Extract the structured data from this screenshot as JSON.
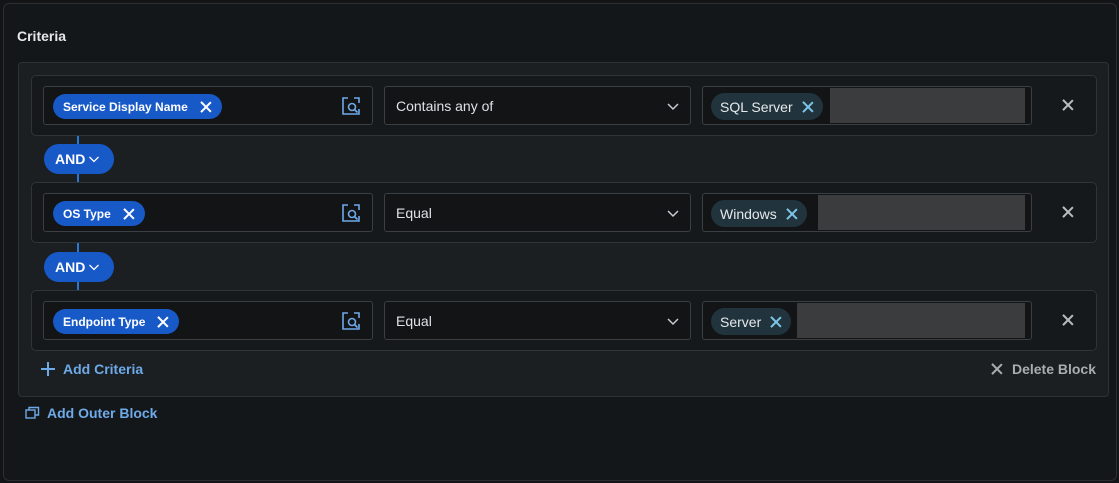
{
  "section": {
    "title": "Criteria"
  },
  "rows": [
    {
      "attribute": "Service Display Name",
      "operator": "Contains any of",
      "value": "SQL Server"
    },
    {
      "attribute": "OS Type",
      "operator": "Equal",
      "value": "Windows"
    },
    {
      "attribute": "Endpoint Type",
      "operator": "Equal",
      "value": "Server"
    }
  ],
  "connectors": [
    {
      "label": "AND"
    },
    {
      "label": "AND"
    }
  ],
  "actions": {
    "add_criteria": "Add Criteria",
    "delete_block": "Delete Block",
    "add_outer_block": "Add Outer Block"
  },
  "colors": {
    "accent": "#1859c8",
    "link": "#6ea9e8",
    "value_chip": "#21343d",
    "background": "#121416"
  },
  "icons": {
    "attribute_lookup": "lookup-icon",
    "remove_chip": "close-icon",
    "dropdown": "chevron-down-icon",
    "remove_row": "close-icon",
    "add": "plus-icon",
    "outer_block": "copy-block-icon"
  }
}
